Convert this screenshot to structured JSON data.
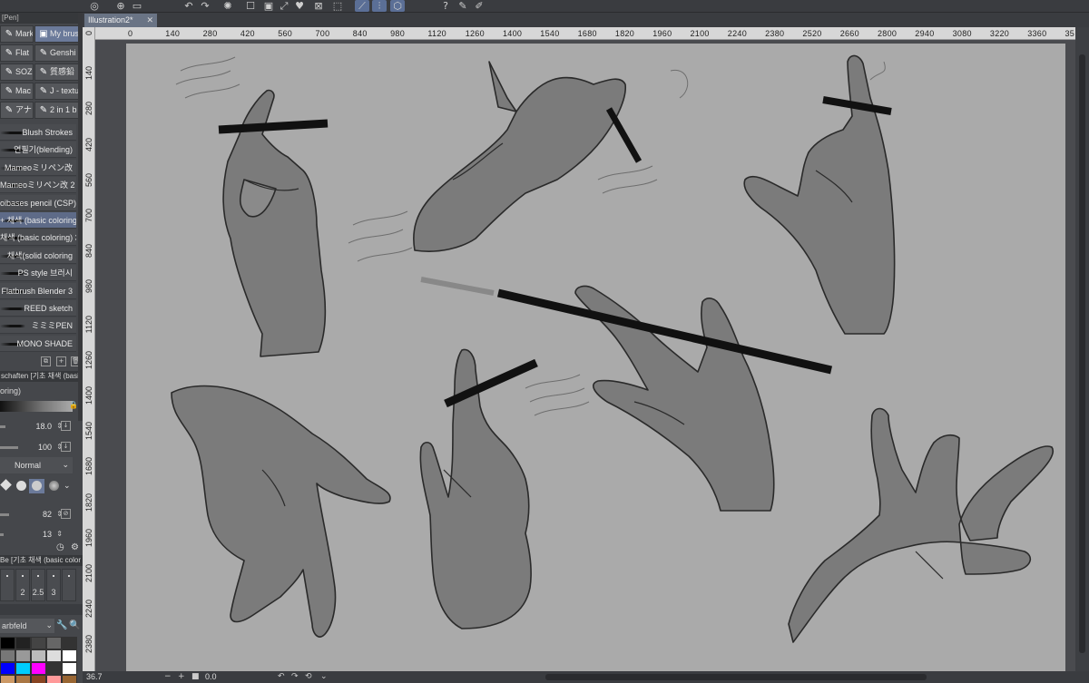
{
  "app": {
    "doc_tab": "Illustration2*",
    "panel_label": "[Pen]"
  },
  "toolbar_icons": [
    "app-icon",
    "new-icon",
    "open-icon",
    "undo-icon",
    "redo-icon",
    "loading-icon",
    "clear-icon",
    "fill-icon",
    "transform-icon",
    "heart-icon",
    "select-off-icon",
    "select-all-icon",
    "snap-ruler-icon",
    "snap-grid-icon",
    "snap-special-icon",
    "help-icon",
    "pen-setting-icon",
    "eraser-setting-icon"
  ],
  "brush_tabs": [
    {
      "label": "Marker",
      "icon": "✎",
      "active": false
    },
    {
      "label": "My brus",
      "icon": "▣",
      "active": true
    },
    {
      "label": "Flat",
      "icon": "✎",
      "active": false
    },
    {
      "label": "Genshi",
      "icon": "✎",
      "active": false
    },
    {
      "label": "SOZOM",
      "icon": "✎",
      "active": false
    },
    {
      "label": "質感鉛",
      "icon": "✎",
      "active": false
    },
    {
      "label": "Mac Sm",
      "icon": "✎",
      "active": false
    },
    {
      "label": "J - textu",
      "icon": "✎",
      "active": false
    },
    {
      "label": "アナログ",
      "icon": "✎",
      "active": false
    },
    {
      "label": "2 in 1 b",
      "icon": "✎",
      "active": false
    }
  ],
  "brushes": [
    {
      "label": "Blush Strokes",
      "active": false
    },
    {
      "label": "연필기(blending)",
      "active": false
    },
    {
      "label": "Mameoミリペン改",
      "active": false
    },
    {
      "label": "Mameoミリペン改 2",
      "active": false
    },
    {
      "label": "oibases pencil (CSP)",
      "active": false
    },
    {
      "label": "+ 채색 (basic coloring)",
      "active": true
    },
    {
      "label": "채색 (basic coloring) 3",
      "active": false
    },
    {
      "label": "채색(solid coloring",
      "active": false
    },
    {
      "label": "PS style 브러시",
      "active": false
    },
    {
      "label": "Flatbrush Blender 3",
      "active": false
    },
    {
      "label": "REED sketch",
      "active": false
    },
    {
      "label": "ミミミPEN",
      "active": false
    },
    {
      "label": "MONO SHADE",
      "active": false
    }
  ],
  "tool_property": {
    "title": "schaften [기초 채색 (basic",
    "subtitle": "oring)",
    "brush_size": "18.0",
    "opacity": "100",
    "blend_mode": "Normal",
    "density": "82",
    "stabilization": "13"
  },
  "brush_size_palette": {
    "title": "Be [기초 채색 (basic color",
    "sizes": [
      "2",
      "2.5",
      "3"
    ]
  },
  "color_set": {
    "label": "arbfeld",
    "swatches": [
      "#000000",
      "#222222",
      "#444444",
      "#666666",
      "#333333",
      "#777777",
      "#999999",
      "#bbbbbb",
      "#dddddd",
      "#ffffff",
      "#0000ff",
      "#00ccff",
      "#ff00ff",
      "#333333",
      "#ffffff",
      "#cc9966",
      "#aa7744",
      "#884422",
      "#ff9999",
      "#996633"
    ]
  },
  "ruler": {
    "top_ticks": [
      "0",
      "140",
      "280",
      "420",
      "560",
      "700",
      "840",
      "980",
      "1120",
      "1260",
      "1400",
      "1540",
      "1680",
      "1820",
      "1960",
      "2100",
      "2240",
      "2380",
      "2520",
      "2660",
      "2800",
      "2940",
      "3080",
      "3220",
      "3360",
      "35"
    ],
    "left_ticks": [
      "0",
      "140",
      "280",
      "420",
      "560",
      "700",
      "840",
      "980",
      "1120",
      "1260",
      "1400",
      "1540",
      "1680",
      "1820",
      "1960",
      "2100",
      "2240",
      "2380"
    ]
  },
  "status": {
    "zoom": "36.7",
    "angle": "0.0"
  }
}
